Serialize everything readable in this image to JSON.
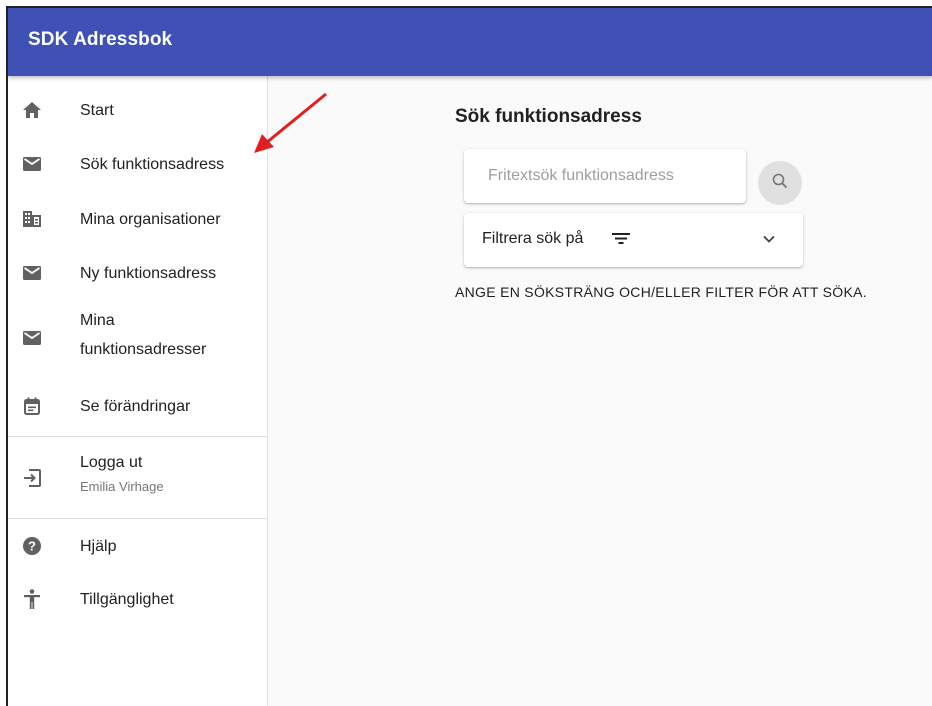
{
  "app": {
    "title": "SDK Adressbok"
  },
  "sidebar": {
    "items": [
      {
        "label": "Start",
        "icon": "home-icon"
      },
      {
        "label": "Sök funktionsadress",
        "icon": "mail-icon"
      },
      {
        "label": "Mina organisationer",
        "icon": "business-icon"
      },
      {
        "label": "Ny funktionsadress",
        "icon": "mail-icon"
      },
      {
        "label_line1": "Mina",
        "label_line2": "funktionsadresser",
        "icon": "mail-icon"
      },
      {
        "label": "Se förändringar",
        "icon": "event-note-icon"
      },
      {
        "label": "Logga ut",
        "sublabel": "Emilia Virhage",
        "icon": "exit-to-app-icon"
      },
      {
        "label": "Hjälp",
        "icon": "help-icon"
      },
      {
        "label": "Tillgänglighet",
        "icon": "accessibility-icon"
      }
    ]
  },
  "main": {
    "title": "Sök funktionsadress",
    "search": {
      "placeholder": "Fritextsök funktionsadress",
      "value": ""
    },
    "filter": {
      "label": "Filtrera sök på"
    },
    "hint": "ANGE EN SÖKSTRÄNG OCH/ELLER FILTER FÖR ATT SÖKA."
  },
  "colors": {
    "appbar": "#3f51b5",
    "icon": "#616161",
    "annotation_arrow": "#e02020"
  }
}
